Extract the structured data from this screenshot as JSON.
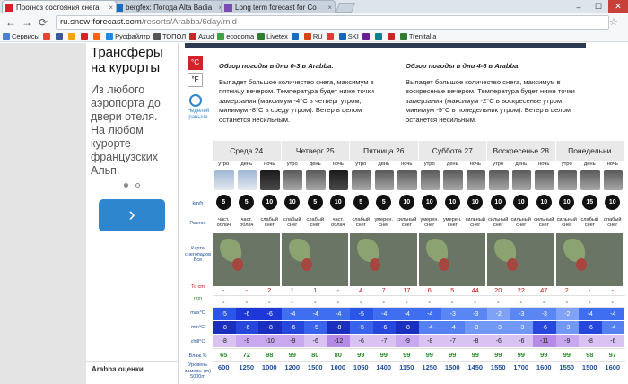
{
  "browser": {
    "tabs": [
      {
        "title": "Прогноз состояния снега",
        "active": true,
        "favicon_color": "#d2232a"
      },
      {
        "title": "bergfex: Погода Alta Badia",
        "active": false,
        "favicon_color": "#1a6cc0"
      },
      {
        "title": "Long term forecast for Co",
        "active": false,
        "favicon_color": "#7a4db3"
      }
    ],
    "url_host": "ru.snow-forecast.com",
    "url_path": "/resorts/Arabba/6day/mid",
    "bookmarks": [
      {
        "label": "Сервисы",
        "color": "#4a7fd3"
      },
      {
        "label": "",
        "color": "#ea4335"
      },
      {
        "label": "",
        "color": "#3b5998"
      },
      {
        "label": "",
        "color": "#f4a300"
      },
      {
        "label": "",
        "color": "#d2232a"
      },
      {
        "label": "",
        "color": "#ff6600"
      },
      {
        "label": "Русфайлтр",
        "color": "#1e88e5"
      },
      {
        "label": "ТОПОЛ",
        "color": "#555555"
      },
      {
        "label": "Azud",
        "color": "#c62828"
      },
      {
        "label": "ecodoma",
        "color": "#43a047"
      },
      {
        "label": "Livetex",
        "color": "#2e7d32"
      },
      {
        "label": "",
        "color": "#1a6cc0"
      },
      {
        "label": "RU",
        "color": "#d84315"
      },
      {
        "label": "",
        "color": "#e53935"
      },
      {
        "label": "SKI",
        "color": "#1565c0"
      },
      {
        "label": "",
        "color": "#6a1b9a"
      },
      {
        "label": "",
        "color": "#00838f"
      },
      {
        "label": "",
        "color": "#c62828"
      },
      {
        "label": "Trenitalia",
        "color": "#2e7d32"
      }
    ]
  },
  "promo": {
    "title": "Трансферы на курорты",
    "body": "Из любого аэропорта до двери отеля. На любом курорте французских Альп.",
    "next_glyph": "›"
  },
  "rating_label": "Arabba оценки",
  "units": {
    "celsius": "°C",
    "fahrenheit": "°F",
    "clock_label": "Неделей раньше"
  },
  "summary": [
    {
      "title": "Обзор погоды в дни 0-3 в Arabba:",
      "text": "Выпадет большое количество снега, максимум в пятницу вечером. Температура будет ниже точки замерзания (максимум -4°C в четверг утром, минимум -8°C в среду утром). Ветер в целом останется несильным."
    },
    {
      "title": "Обзор погоды в дни 4-6 в Arabba:",
      "text": "Выпадет большое количество снега, максимум в воскресенье вечером. Температура будет ниже точки замерзания (максимум -2°C в воскресенье утром, минимум -9°C в понедельник утром). Ветер в целом останется несильным."
    }
  ],
  "forecast": {
    "row_labels": {
      "wind": "km/h",
      "snow_type": "Разное",
      "map": "Карта снегопадов Все",
      "snow_cm": "Тс cm",
      "rain_mm": "mm",
      "max": "max°C",
      "min": "min°C",
      "chill": "chill°C",
      "humidity": "Влаж.%",
      "freeze": "Уровень замерз. (m) 5000m"
    },
    "days": [
      "Среда 24",
      "Четверг 25",
      "Пятница 26",
      "Суббота 27",
      "Воскресенье 28",
      "Понедельни"
    ],
    "periods": [
      "утро",
      "день",
      "ночь",
      "утро",
      "день",
      "ночь",
      "утро",
      "день",
      "ночь",
      "утро",
      "день",
      "ночь",
      "утро",
      "день",
      "ночь",
      "утро",
      "день",
      "ночь"
    ],
    "icons": [
      "partly",
      "partly",
      "night",
      "snow",
      "snow",
      "night",
      "snow",
      "snow",
      "snow",
      "snow",
      "snow",
      "snow",
      "snow",
      "snow",
      "snow",
      "snow",
      "snow",
      "snow"
    ],
    "wind": [
      "5",
      "5",
      "10",
      "10",
      "5",
      "10",
      "5",
      "5",
      "10",
      "10",
      "10",
      "10",
      "10",
      "10",
      "10",
      "10",
      "15",
      "10"
    ],
    "snow_type": [
      "част. облач",
      "част. облач",
      "слабый снег",
      "слабый снег",
      "слабый снег",
      "част. облач",
      "слабый снег",
      "умерен. снег",
      "сильный снег",
      "умерен. снег",
      "умерен. снег",
      "сильный снег",
      "сильный снег",
      "сильный снег",
      "сильный снег",
      "сильный снег",
      "слабый снег",
      "слабый снег"
    ],
    "snow_cm": [
      "-",
      "-",
      "2",
      "1",
      "1",
      "-",
      "4",
      "7",
      "17",
      "6",
      "5",
      "44",
      "20",
      "22",
      "47",
      "2",
      "-",
      "-"
    ],
    "rain_mm": [
      "-",
      "-",
      "-",
      "-",
      "-",
      "-",
      "-",
      "-",
      "-",
      "-",
      "-",
      "-",
      "-",
      "-",
      "-",
      "-",
      "-",
      "-"
    ],
    "max": [
      "-5",
      "-6",
      "-6",
      "-4",
      "-4",
      "-4",
      "-5",
      "-4",
      "-4",
      "-4",
      "-3",
      "-3",
      "-2",
      "-3",
      "-3",
      "-2",
      "-4",
      "-4"
    ],
    "min": [
      "-8",
      "-6",
      "-8",
      "-6",
      "-5",
      "-8",
      "-5",
      "-6",
      "-8",
      "-4",
      "-4",
      "-3",
      "-3",
      "-3",
      "-6",
      "-3",
      "-6",
      "-4"
    ],
    "chill": [
      "-8",
      "-9",
      "-10",
      "-9",
      "-6",
      "-12",
      "-6",
      "-7",
      "-9",
      "-8",
      "-7",
      "-8",
      "-6",
      "-6",
      "-11",
      "-9",
      "-8",
      "-6"
    ],
    "humidity": [
      "65",
      "72",
      "98",
      "99",
      "80",
      "80",
      "99",
      "99",
      "99",
      "99",
      "99",
      "99",
      "99",
      "99",
      "99",
      "99",
      "98",
      "97"
    ],
    "freeze": [
      "600",
      "1250",
      "1000",
      "1200",
      "1500",
      "1000",
      "1050",
      "1400",
      "1150",
      "1250",
      "1500",
      "1450",
      "1550",
      "1700",
      "1600",
      "1550",
      "1500",
      "1600"
    ]
  }
}
